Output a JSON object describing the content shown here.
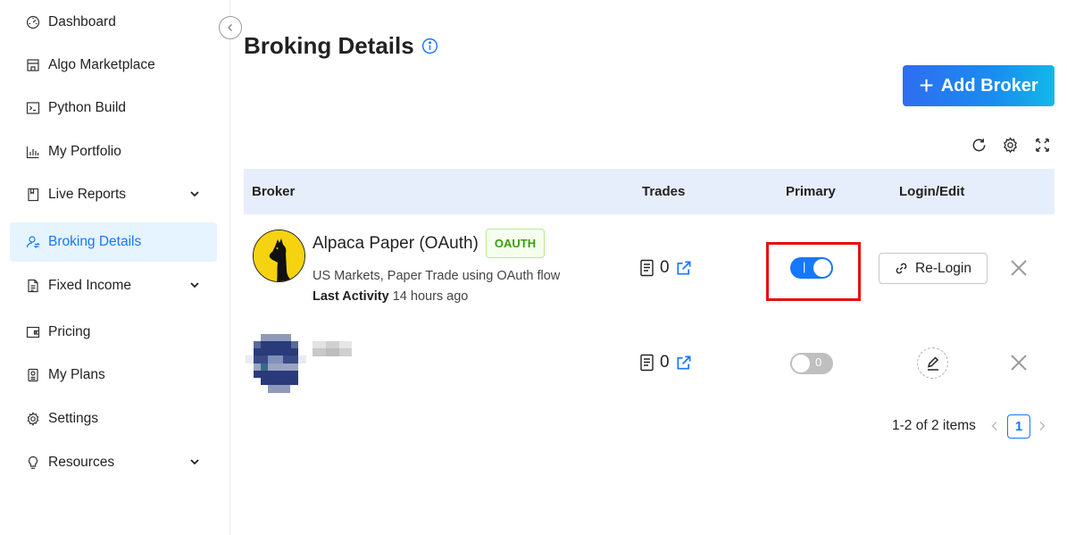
{
  "sidebar": {
    "items": [
      {
        "label": "Dashboard",
        "icon": "dashboard-gauge-icon"
      },
      {
        "label": "Algo Marketplace",
        "icon": "shop-icon"
      },
      {
        "label": "Python Build",
        "icon": "terminal-icon"
      },
      {
        "label": "My Portfolio",
        "icon": "bar-chart-icon"
      },
      {
        "label": "Live Reports",
        "icon": "book-icon",
        "expandable": true
      },
      {
        "label": "Broking Details",
        "icon": "user-switch-icon",
        "active": true
      },
      {
        "label": "Fixed Income",
        "icon": "file-text-icon",
        "expandable": true
      },
      {
        "label": "Pricing",
        "icon": "wallet-icon"
      },
      {
        "label": "My Plans",
        "icon": "calculator-icon"
      },
      {
        "label": "Settings",
        "icon": "gear-icon"
      },
      {
        "label": "Resources",
        "icon": "bulb-icon",
        "expandable": true
      }
    ]
  },
  "header": {
    "title": "Broking Details",
    "add_broker_label": "Add Broker"
  },
  "table": {
    "columns": {
      "broker": "Broker",
      "trades": "Trades",
      "primary": "Primary",
      "login_edit": "Login/Edit"
    },
    "rows": [
      {
        "name": "Alpaca Paper (OAuth)",
        "badge": "OAUTH",
        "description": "US Markets, Paper Trade using OAuth flow",
        "last_activity_label": "Last Activity",
        "last_activity_value": "14 hours ago",
        "trades": "0",
        "primary": true,
        "primary_toggle_text": "|",
        "action_label": "Re-Login"
      },
      {
        "name": "",
        "trades": "0",
        "primary": false,
        "primary_toggle_text": "0",
        "action": "edit"
      }
    ]
  },
  "pagination": {
    "summary": "1-2 of 2 items",
    "current_page": "1"
  },
  "colors": {
    "accent": "#1677ff",
    "header_bg": "#e7eefb",
    "active_nav_bg": "#e6f4ff",
    "oauth_green": "#389e0d",
    "highlight_red": "#e31010"
  }
}
